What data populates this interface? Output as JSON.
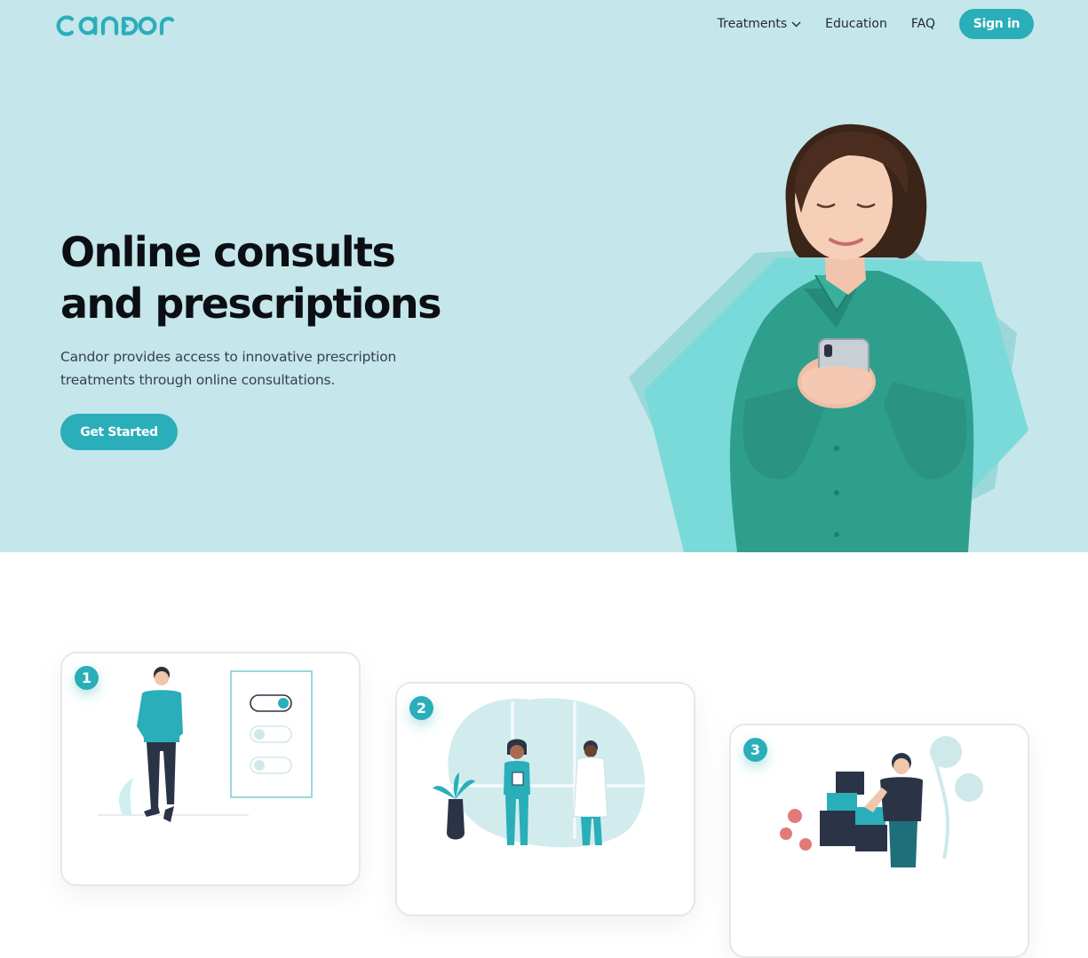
{
  "brand": {
    "name": "candor"
  },
  "nav": {
    "items": [
      {
        "label": "Treatments",
        "has_dropdown": true
      },
      {
        "label": "Education"
      },
      {
        "label": "FAQ"
      }
    ],
    "signin_label": "Sign in"
  },
  "hero": {
    "headline_line1": "Online consults",
    "headline_line2": "and prescriptions",
    "subtext": "Candor provides access to innovative prescription treatments through online consultations.",
    "cta_label": "Get Started"
  },
  "steps": [
    {
      "number": "1"
    },
    {
      "number": "2"
    },
    {
      "number": "3"
    }
  ],
  "colors": {
    "accent": "#2aaeb9",
    "hero_bg": "#c5e6ea",
    "text_dark": "#0b0f14"
  }
}
